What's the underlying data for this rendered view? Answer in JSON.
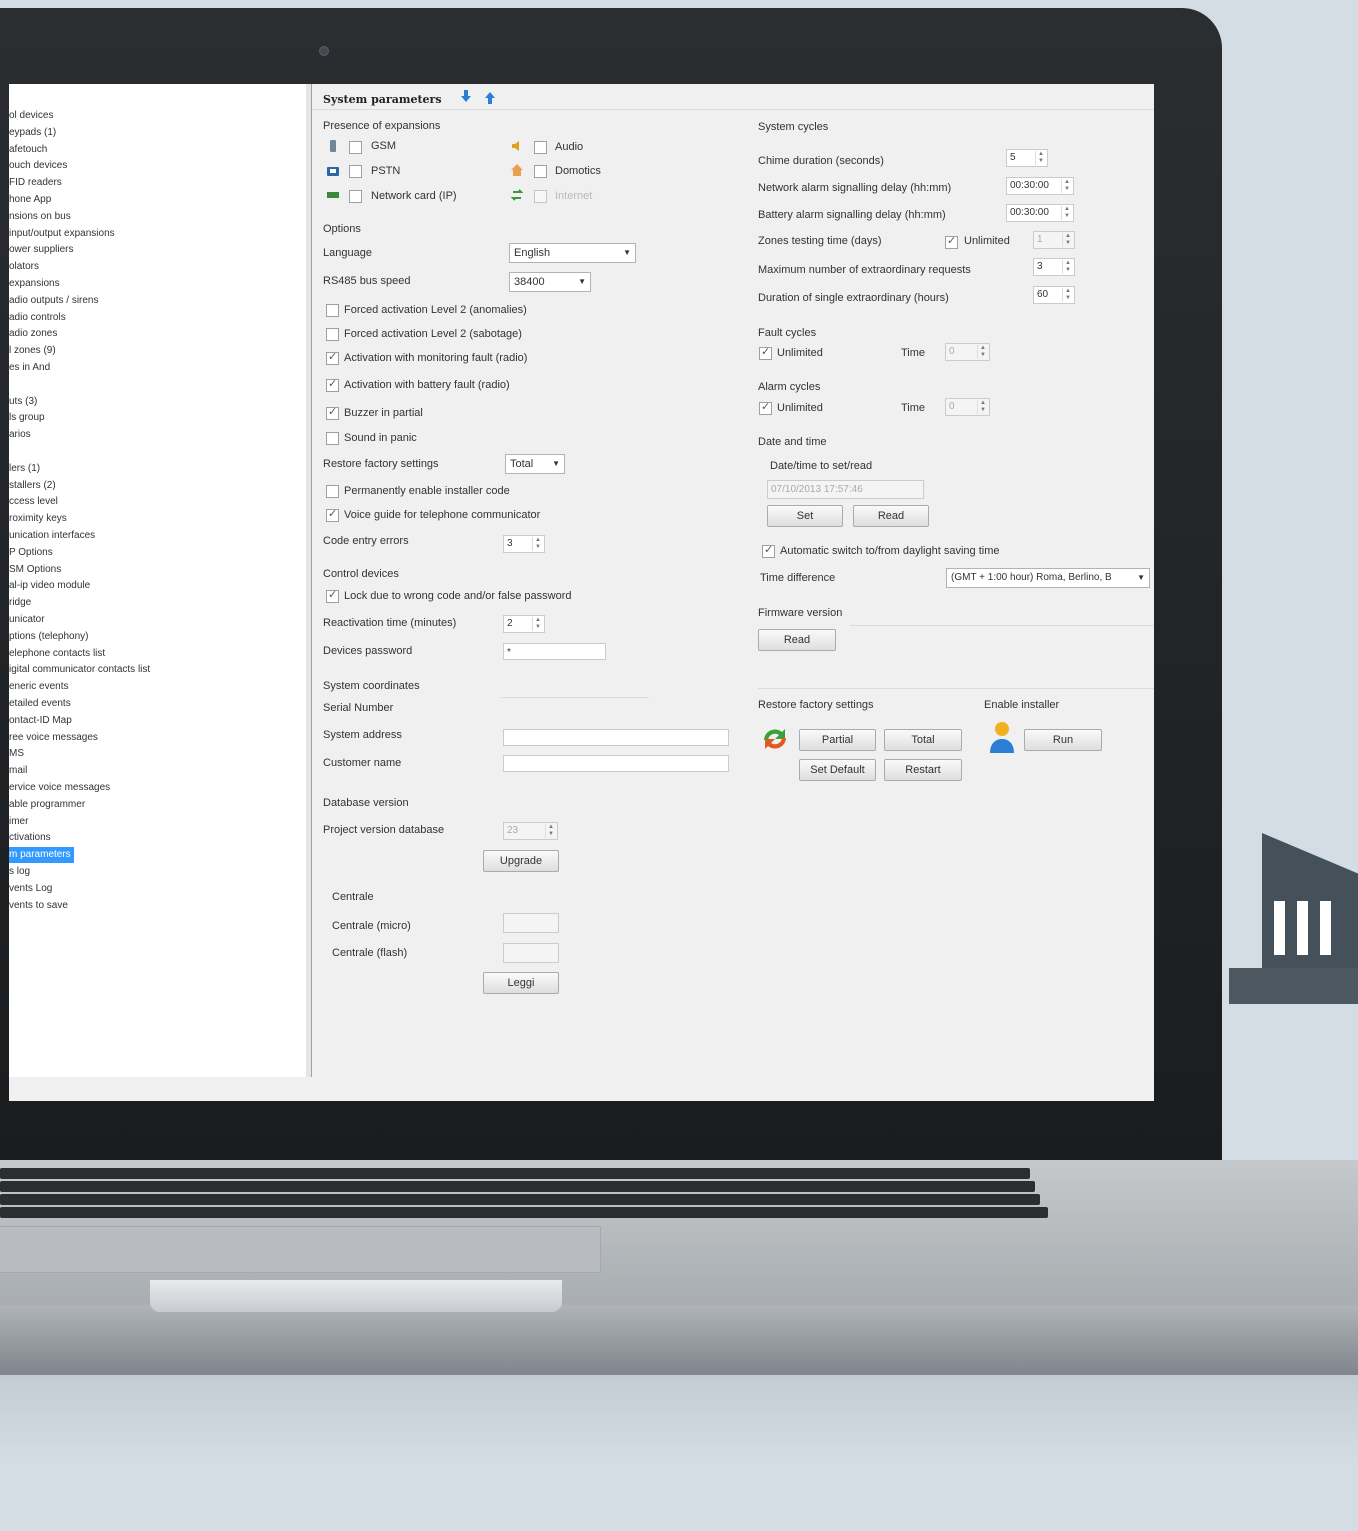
{
  "tree": {
    "items": [
      "ol devices",
      "eypads (1)",
      "afetouch",
      "ouch devices",
      "FID readers",
      "hone App",
      "nsions on bus",
      "input/output expansions",
      "ower suppliers",
      "olators",
      "expansions",
      "adio outputs / sirens",
      "adio controls",
      "adio zones",
      "l zones (9)",
      "es in And",
      "",
      "uts (3)",
      "ls group",
      "arios",
      "",
      "lers (1)",
      "stallers (2)",
      "ccess level",
      "roximity keys",
      "unication interfaces",
      "P Options",
      "SM Options",
      "al-ip video module",
      "ridge",
      "unicator",
      "ptions (telephony)",
      "elephone contacts list",
      "igital communicator contacts list",
      "eneric events",
      "etailed events",
      "ontact-ID Map",
      "ree voice messages",
      "MS",
      "mail",
      "ervice voice messages",
      "able programmer",
      "imer",
      "ctivations",
      "m parameters",
      "s log",
      "vents Log",
      "vents to save"
    ],
    "selected_index": 44
  },
  "header": {
    "title": "System parameters"
  },
  "left": {
    "presence_title": "Presence of expansions",
    "expansions": [
      {
        "label": "GSM",
        "checked": false,
        "icon": "phone-icon"
      },
      {
        "label": "PSTN",
        "checked": false,
        "icon": "telephone-icon"
      },
      {
        "label": "Network card (IP)",
        "checked": false,
        "icon": "network-card-icon"
      },
      {
        "label": "Audio",
        "checked": false,
        "icon": "speaker-icon"
      },
      {
        "label": "Domotics",
        "checked": false,
        "icon": "home-icon"
      },
      {
        "label": "Internet",
        "checked": false,
        "icon": "internet-icon"
      }
    ],
    "options_title": "Options",
    "language_label": "Language",
    "language_value": "English",
    "bus_speed_label": "RS485 bus speed",
    "bus_speed_value": "38400",
    "options": [
      {
        "label": "Forced activation Level 2 (anomalies)",
        "checked": false
      },
      {
        "label": "Forced activation Level 2 (sabotage)",
        "checked": false
      },
      {
        "label": "Activation with monitoring fault (radio)",
        "checked": true
      },
      {
        "label": "Activation with battery fault (radio)",
        "checked": true
      },
      {
        "label": "Buzzer in partial",
        "checked": true
      },
      {
        "label": "Sound in panic",
        "checked": false
      }
    ],
    "restore_label": "Restore factory settings",
    "restore_value": "Total",
    "perm_installer_label": "Permanently enable installer code",
    "perm_installer_checked": false,
    "voice_guide_label": "Voice guide for telephone communicator",
    "voice_guide_checked": true,
    "code_errors_label": "Code entry errors",
    "code_errors_value": "3",
    "control_devices_title": "Control devices",
    "lock_label": "Lock due to wrong code and/or false password",
    "lock_checked": true,
    "reactivation_label": "Reactivation time (minutes)",
    "reactivation_value": "2",
    "devices_password_label": "Devices password",
    "devices_password_value": "*",
    "coords_title": "System coordinates",
    "serial_label": "Serial Number",
    "address_label": "System address",
    "customer_label": "Customer name",
    "db_title": "Database version",
    "project_db_label": "Project version database",
    "project_db_value": "23",
    "upgrade_button": "Upgrade",
    "centrale_title": "Centrale",
    "centrale_micro_label": "Centrale (micro)",
    "centrale_flash_label": "Centrale (flash)",
    "leggi_button": "Leggi"
  },
  "right": {
    "cycles_title": "System cycles",
    "chime_label": "Chime duration (seconds)",
    "chime_value": "5",
    "net_alarm_label": "Network alarm signalling delay (hh:mm)",
    "net_alarm_value": "00:30:00",
    "batt_alarm_label": "Battery alarm signalling delay (hh:mm)",
    "batt_alarm_value": "00:30:00",
    "zones_test_label": "Zones testing time (days)",
    "zones_unlimited_label": "Unlimited",
    "zones_test_value": "1",
    "max_requests_label": "Maximum number of extraordinary requests",
    "max_requests_value": "3",
    "duration_label": "Duration of single extraordinary (hours)",
    "duration_value": "60",
    "fault_title": "Fault cycles",
    "fault_unlimited": "Unlimited",
    "fault_time_label": "Time",
    "fault_time_value": "0",
    "alarm_title": "Alarm cycles",
    "alarm_unlimited": "Unlimited",
    "alarm_time_label": "Time",
    "alarm_time_value": "0",
    "datetime_title": "Date and time",
    "datetime_sub": "Date/time to set/read",
    "datetime_value": "07/10/2013 17:57:46",
    "set_button": "Set",
    "read_button": "Read",
    "dst_label": "Automatic switch to/from daylight saving time",
    "time_diff_label": "Time difference",
    "time_diff_value": "(GMT + 1:00 hour) Roma, Berlino, B",
    "firmware_title": "Firmware version",
    "firmware_read": "Read",
    "restore_title": "Restore factory settings",
    "partial_button": "Partial",
    "total_button": "Total",
    "set_default_button": "Set Default",
    "restart_button": "Restart",
    "enable_installer_title": "Enable installer",
    "run_button": "Run"
  },
  "colors": {
    "selection": "#3399ff",
    "bezel": "#1f2224",
    "background": "#d3dde3"
  }
}
